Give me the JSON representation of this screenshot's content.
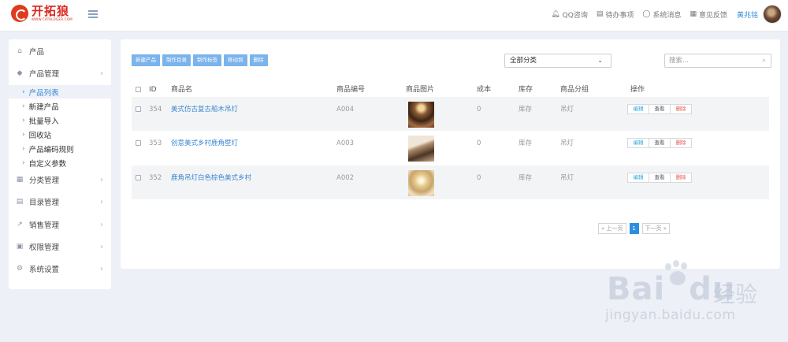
{
  "app": {
    "logo_name": "开拓狼",
    "logo_url": "WWW.CATALOGER.COM"
  },
  "topbar": {
    "links": [
      {
        "icon": "bell-icon",
        "label": "QQ咨询"
      },
      {
        "icon": "clipboard-icon",
        "label": "待办事项"
      },
      {
        "icon": "chat-icon",
        "label": "系统消息"
      },
      {
        "icon": "calendar-icon",
        "label": "意见反馈"
      }
    ],
    "user_name": "黄兆铭"
  },
  "sidebar": {
    "items": [
      {
        "label": "产品",
        "icon": "home-icon",
        "has_chevron": false
      },
      {
        "label": "产品管理",
        "icon": "tags-icon",
        "has_chevron": true
      },
      {
        "label": "分类管理",
        "icon": "table-icon",
        "has_chevron": true
      },
      {
        "label": "目录管理",
        "icon": "document-icon",
        "has_chevron": true
      },
      {
        "label": "销售管理",
        "icon": "chart-line-icon",
        "has_chevron": true
      },
      {
        "label": "权限管理",
        "icon": "lock-icon",
        "has_chevron": true
      },
      {
        "label": "系统设置",
        "icon": "cog-icon",
        "has_chevron": true
      }
    ],
    "sub_items": [
      {
        "label": "产品列表",
        "active": true
      },
      {
        "label": "新建产品",
        "active": false
      },
      {
        "label": "批量导入",
        "active": false
      },
      {
        "label": "回收站",
        "active": false
      },
      {
        "label": "产品编码规则",
        "active": false
      },
      {
        "label": "自定义参数",
        "active": false
      }
    ]
  },
  "toolbar": {
    "buttons": [
      "新建产品",
      "制作目录",
      "制作标签",
      "移动到",
      "删除"
    ],
    "category_select": "全部分类",
    "search_placeholder": "搜索..."
  },
  "table": {
    "headers": [
      "ID",
      "商品名",
      "商品编号",
      "商品图片",
      "成本",
      "库存",
      "商品分组",
      "操作"
    ],
    "rows": [
      {
        "id": "354",
        "name": "美式仿古复古船木吊灯",
        "code": "A004",
        "cost": "0",
        "stock": "库存",
        "group": "吊灯"
      },
      {
        "id": "353",
        "name": "创意美式乡村鹿角壁灯",
        "code": "A003",
        "cost": "0",
        "stock": "库存",
        "group": "吊灯"
      },
      {
        "id": "352",
        "name": "鹿角吊灯白色棕色美式乡村",
        "code": "A002",
        "cost": "0",
        "stock": "库存",
        "group": "吊灯"
      }
    ],
    "actions": {
      "edit": "编辑",
      "view": "查看",
      "delete": "删除"
    }
  },
  "pager": {
    "prev": "上一页",
    "current": "1",
    "next": "下一页"
  },
  "watermark": {
    "brand": "Bai",
    "brand_tail": "du",
    "jingyan": "经验",
    "url": "jingyan.baidu.com"
  }
}
